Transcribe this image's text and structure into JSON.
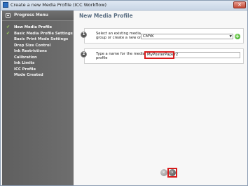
{
  "window": {
    "title": "Create a new Media Profile (ICC Workflow)",
    "close_label": "✕"
  },
  "sidebar": {
    "header": "Progress Menu",
    "items": [
      {
        "label": "New Media Profile",
        "done": true,
        "current": true
      },
      {
        "label": "Basic Media Profile Settings",
        "done": true,
        "current": false
      },
      {
        "label": "Basic Print Mode Settings",
        "done": false,
        "current": false
      },
      {
        "label": "Drop Size Control",
        "done": false,
        "current": false
      },
      {
        "label": "Ink Restrictions",
        "done": false,
        "current": false
      },
      {
        "label": "Calibration",
        "done": false,
        "current": false
      },
      {
        "label": "Ink Limits",
        "done": false,
        "current": false
      },
      {
        "label": "ICC Profile",
        "done": false,
        "current": false
      },
      {
        "label": "Mode Created",
        "done": false,
        "current": false
      }
    ]
  },
  "main": {
    "title": "New Media Profile",
    "step1": {
      "number": "1",
      "text_line1": "Select an existing media",
      "text_line2": "group or create a new one",
      "group_value": "CMYK",
      "add_label": "+"
    },
    "step2": {
      "number": "2",
      "text_line1": "Type a name for the media",
      "text_line2": "profile",
      "name_value": "MyPosterPaper2"
    },
    "nav": {
      "back_label": "‹",
      "next_label": "›"
    }
  },
  "colors": {
    "highlight": "#d81b1b",
    "sidebar_bg": "#666666",
    "title_text": "#5a6e82",
    "add_button": "#2f9a1f"
  }
}
